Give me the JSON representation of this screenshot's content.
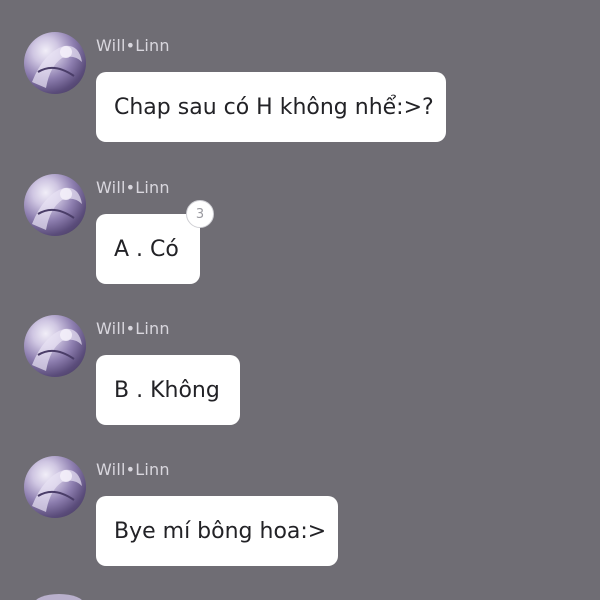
{
  "messages": [
    {
      "sender": "Will•Linn",
      "text": "Chap sau có H không nhể:>?"
    },
    {
      "sender": "Will•Linn",
      "text": "A . Có",
      "reaction_count": "3"
    },
    {
      "sender": "Will•Linn",
      "text": "B . Không"
    },
    {
      "sender": "Will•Linn",
      "text": "Bye mí bông hoa:>"
    }
  ],
  "colors": {
    "background": "#6f6d74",
    "bubble": "#ffffff",
    "sender_text": "#d9d7de",
    "message_text": "#222226"
  }
}
